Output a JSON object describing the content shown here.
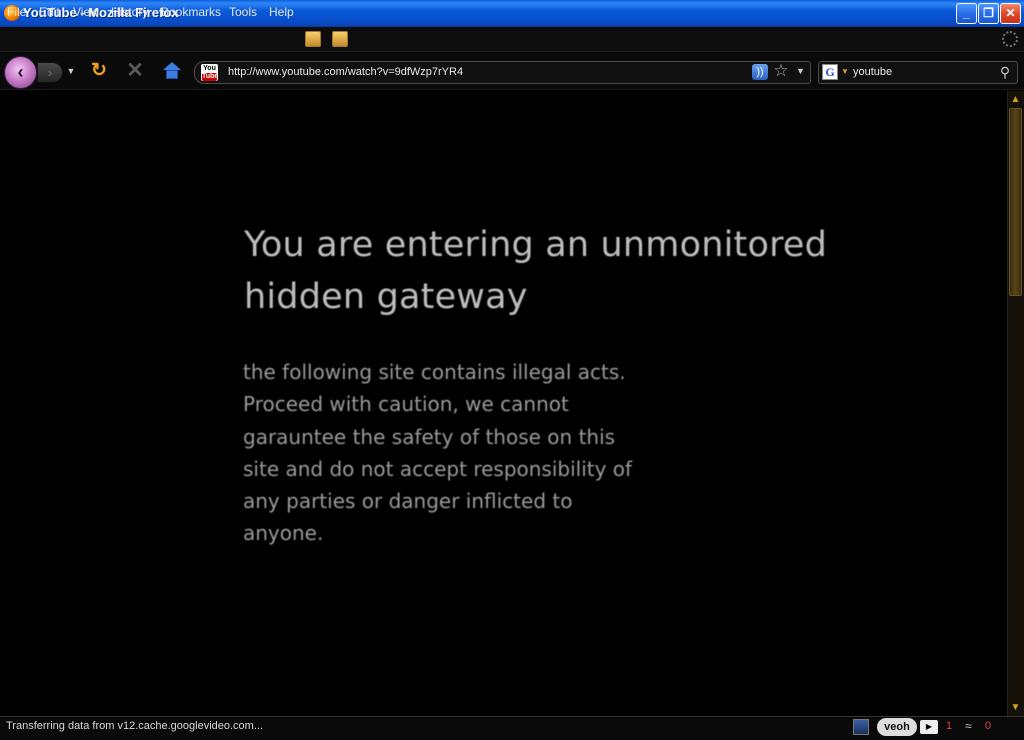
{
  "window": {
    "title": "YouTube - Mozilla Firefox"
  },
  "menu": {
    "file": "File",
    "edit": "Edit",
    "view": "View",
    "history": "History",
    "bookmarks": "Bookmarks",
    "tools": "Tools",
    "help": "Help"
  },
  "nav": {
    "url": "http://www.youtube.com/watch?v=9dfWzp7rYR4",
    "site_icon_top": "You",
    "site_icon_bottom": "Tube",
    "search_engine_letter": "G",
    "search_value": "youtube"
  },
  "content": {
    "headline_line1": "You are entering an unmonitored",
    "headline_line2": "hidden gateway",
    "body_lines": [
      "the following site contains illegal acts.",
      "Proceed with caution, we cannot",
      "garauntee the safety of those on this",
      "site and do not accept responsibility of",
      "any parties or danger inflicted to",
      "anyone."
    ]
  },
  "status": {
    "text": "Transferring data from v12.cache.googlevideo.com...",
    "veoh_label": "veoh",
    "count1": "1",
    "count2": "0"
  },
  "colors": {
    "titlebar": "#0b5ad8",
    "background": "#000000",
    "headline": "#bdbdbd",
    "body": "#9a9a9a",
    "accent_orange": "#f0a020"
  }
}
